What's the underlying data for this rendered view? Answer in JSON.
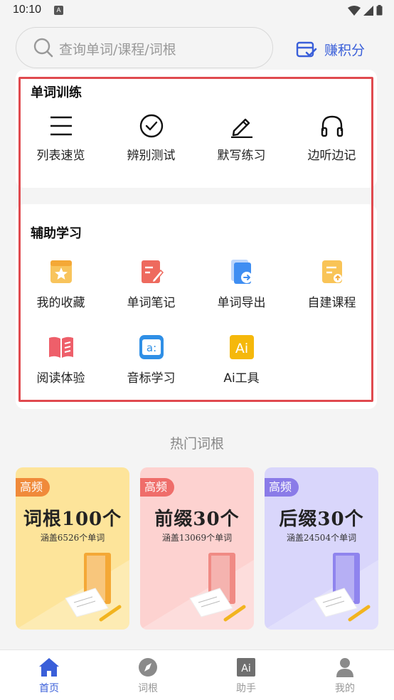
{
  "status_bar": {
    "time": "10:10",
    "notif_letter": "A"
  },
  "search": {
    "placeholder": "查询单词/课程/词根"
  },
  "earn_points": {
    "label": "赚积分"
  },
  "word_training": {
    "title": "单词训练",
    "items": [
      {
        "label": "列表速览",
        "icon": "list-icon"
      },
      {
        "label": "辨别测试",
        "icon": "check-circle-icon"
      },
      {
        "label": "默写练习",
        "icon": "pencil-icon"
      },
      {
        "label": "边听边记",
        "icon": "headphones-icon"
      }
    ]
  },
  "assist_study": {
    "title": "辅助学习",
    "items": [
      {
        "label": "我的收藏",
        "icon": "star-favorite-icon"
      },
      {
        "label": "单词笔记",
        "icon": "note-icon"
      },
      {
        "label": "单词导出",
        "icon": "export-icon"
      },
      {
        "label": "自建课程",
        "icon": "custom-course-icon"
      },
      {
        "label": "阅读体验",
        "icon": "book-icon"
      },
      {
        "label": "音标学习",
        "icon": "phonetic-icon"
      },
      {
        "label": "Ai工具",
        "icon": "ai-icon"
      }
    ]
  },
  "hot_roots": {
    "title": "热门词根",
    "cards": [
      {
        "badge": "高频",
        "main": "词根100个",
        "sub": "涵盖6526个单词",
        "bg": "#fde49a",
        "badge_color": "#f08a3a",
        "book_color": "#f4a836"
      },
      {
        "badge": "高频",
        "main": "前缀30个",
        "sub": "涵盖13069个单词",
        "bg": "#fdd2d0",
        "badge_color": "#ef6d6a",
        "book_color": "#f08a84"
      },
      {
        "badge": "高频",
        "main": "后缀30个",
        "sub": "涵盖24504个单词",
        "bg": "#d9d6fb",
        "badge_color": "#8a7be8",
        "book_color": "#8f84ee"
      }
    ]
  },
  "tabbar": {
    "items": [
      {
        "label": "首页",
        "icon": "home-icon",
        "active": true
      },
      {
        "label": "词根",
        "icon": "compass-icon",
        "active": false
      },
      {
        "label": "助手",
        "icon": "ai-assistant-icon",
        "active": false
      },
      {
        "label": "我的",
        "icon": "user-icon",
        "active": false
      }
    ]
  },
  "colors": {
    "accent": "#3a5fd9",
    "highlight": "#e04a4f"
  }
}
